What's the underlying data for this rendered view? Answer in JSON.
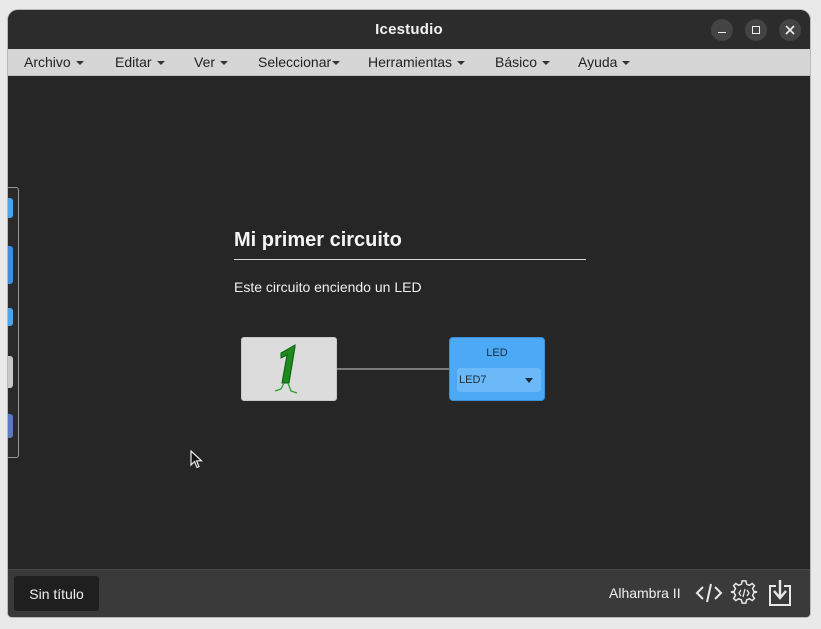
{
  "window": {
    "title": "Icestudio"
  },
  "menu": [
    {
      "label": "Archivo"
    },
    {
      "label": "Editar"
    },
    {
      "label": "Ver"
    },
    {
      "label": "Seleccionar"
    },
    {
      "label": "Herramientas"
    },
    {
      "label": "Básico"
    },
    {
      "label": "Ayuda"
    }
  ],
  "canvas": {
    "info_title": "Mi primer circuito",
    "info_description": "Este circuito enciendo un LED",
    "constant_block": {
      "value": "1",
      "icon": "bit-one-icon"
    },
    "led_block": {
      "label": "LED",
      "selected_pin": "LED7"
    }
  },
  "footer": {
    "filename": "Sin título",
    "board": "Alhambra II",
    "icons": [
      "code-icon",
      "settings-gear-icon",
      "download-icon"
    ]
  },
  "colors": {
    "canvas_bg": "#262626",
    "menubar_bg": "#d6d6d6",
    "led_block": "#4ba9f6",
    "constant_block": "#dcdcdc",
    "bit_green": "#1c8a1c"
  }
}
